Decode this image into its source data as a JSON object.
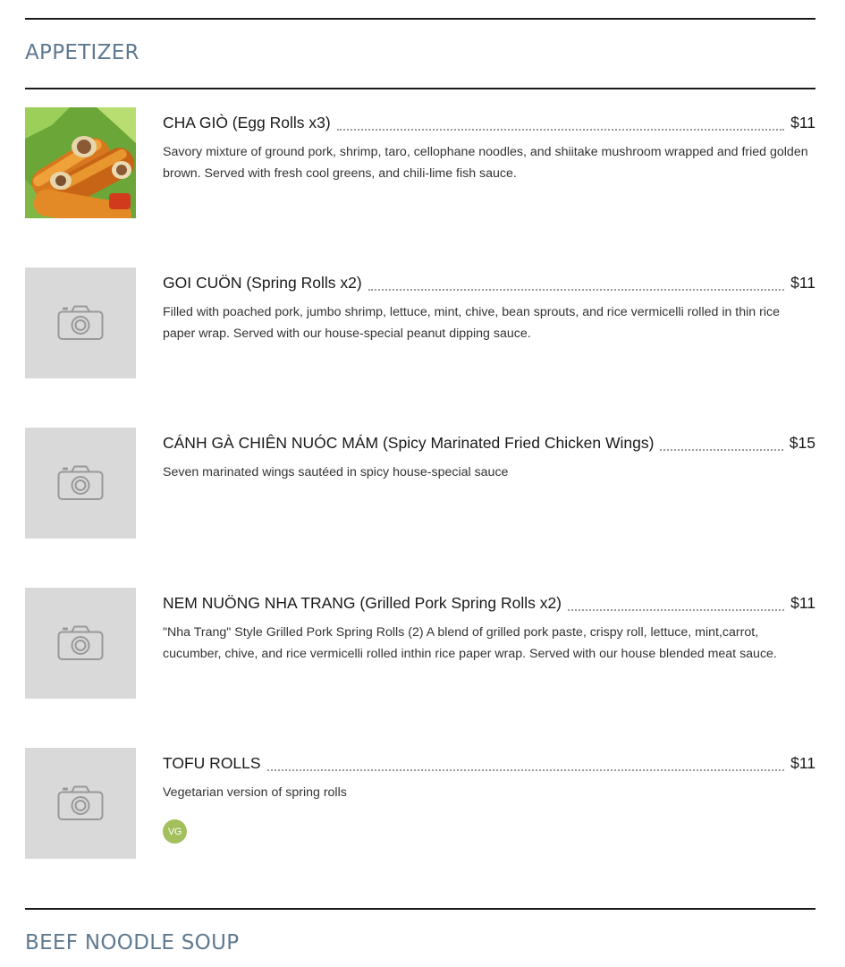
{
  "sections": [
    {
      "title": "APPETIZER",
      "items": [
        {
          "name": "CHA GIÒ (Egg Rolls x3)",
          "price": "$11",
          "description": "Savory mixture of ground pork, shrimp, taro, cellophane noodles, and shiitake mushroom wrapped and fried golden brown. Served with fresh cool greens, and chili-lime fish sauce.",
          "image": "egg-rolls-photo"
        },
        {
          "name": "GOI CUÖN (Spring Rolls x2)",
          "price": "$11",
          "description": "Filled with poached pork, jumbo shrimp, lettuce, mint, chive, bean sprouts, and rice vermicelli rolled in thin rice paper wrap. Served with our house-special peanut dipping sauce.",
          "image": "camera-icon"
        },
        {
          "name": "CÁNH GÀ CHIÊN NUÓC MÁM (Spicy Marinated Fried Chicken Wings)",
          "price": "$15",
          "description": "Seven marinated wings sautéed in spicy house-special sauce",
          "image": "camera-icon"
        },
        {
          "name": "NEM NUÖNG NHA TRANG (Grilled Pork Spring Rolls x2)",
          "price": "$11",
          "description": "\"Nha Trang\" Style Grilled Pork Spring Rolls (2) A blend of grilled pork paste, crispy roll, lettuce, mint,carrot, cucumber, chive, and rice vermicelli rolled inthin rice paper wrap. Served with our house blended meat sauce.",
          "image": "camera-icon"
        },
        {
          "name": "TOFU ROLLS",
          "price": "$11",
          "description": "Vegetarian version of spring rolls",
          "image": "camera-icon",
          "badge": "VG"
        }
      ]
    },
    {
      "title": "BEEF NOODLE SOUP"
    }
  ],
  "colors": {
    "section_title": "#5f7a90",
    "placeholder_bg": "#d9d9d9",
    "camera_icon": "#999999",
    "vegan_badge": "#a4c05c"
  }
}
